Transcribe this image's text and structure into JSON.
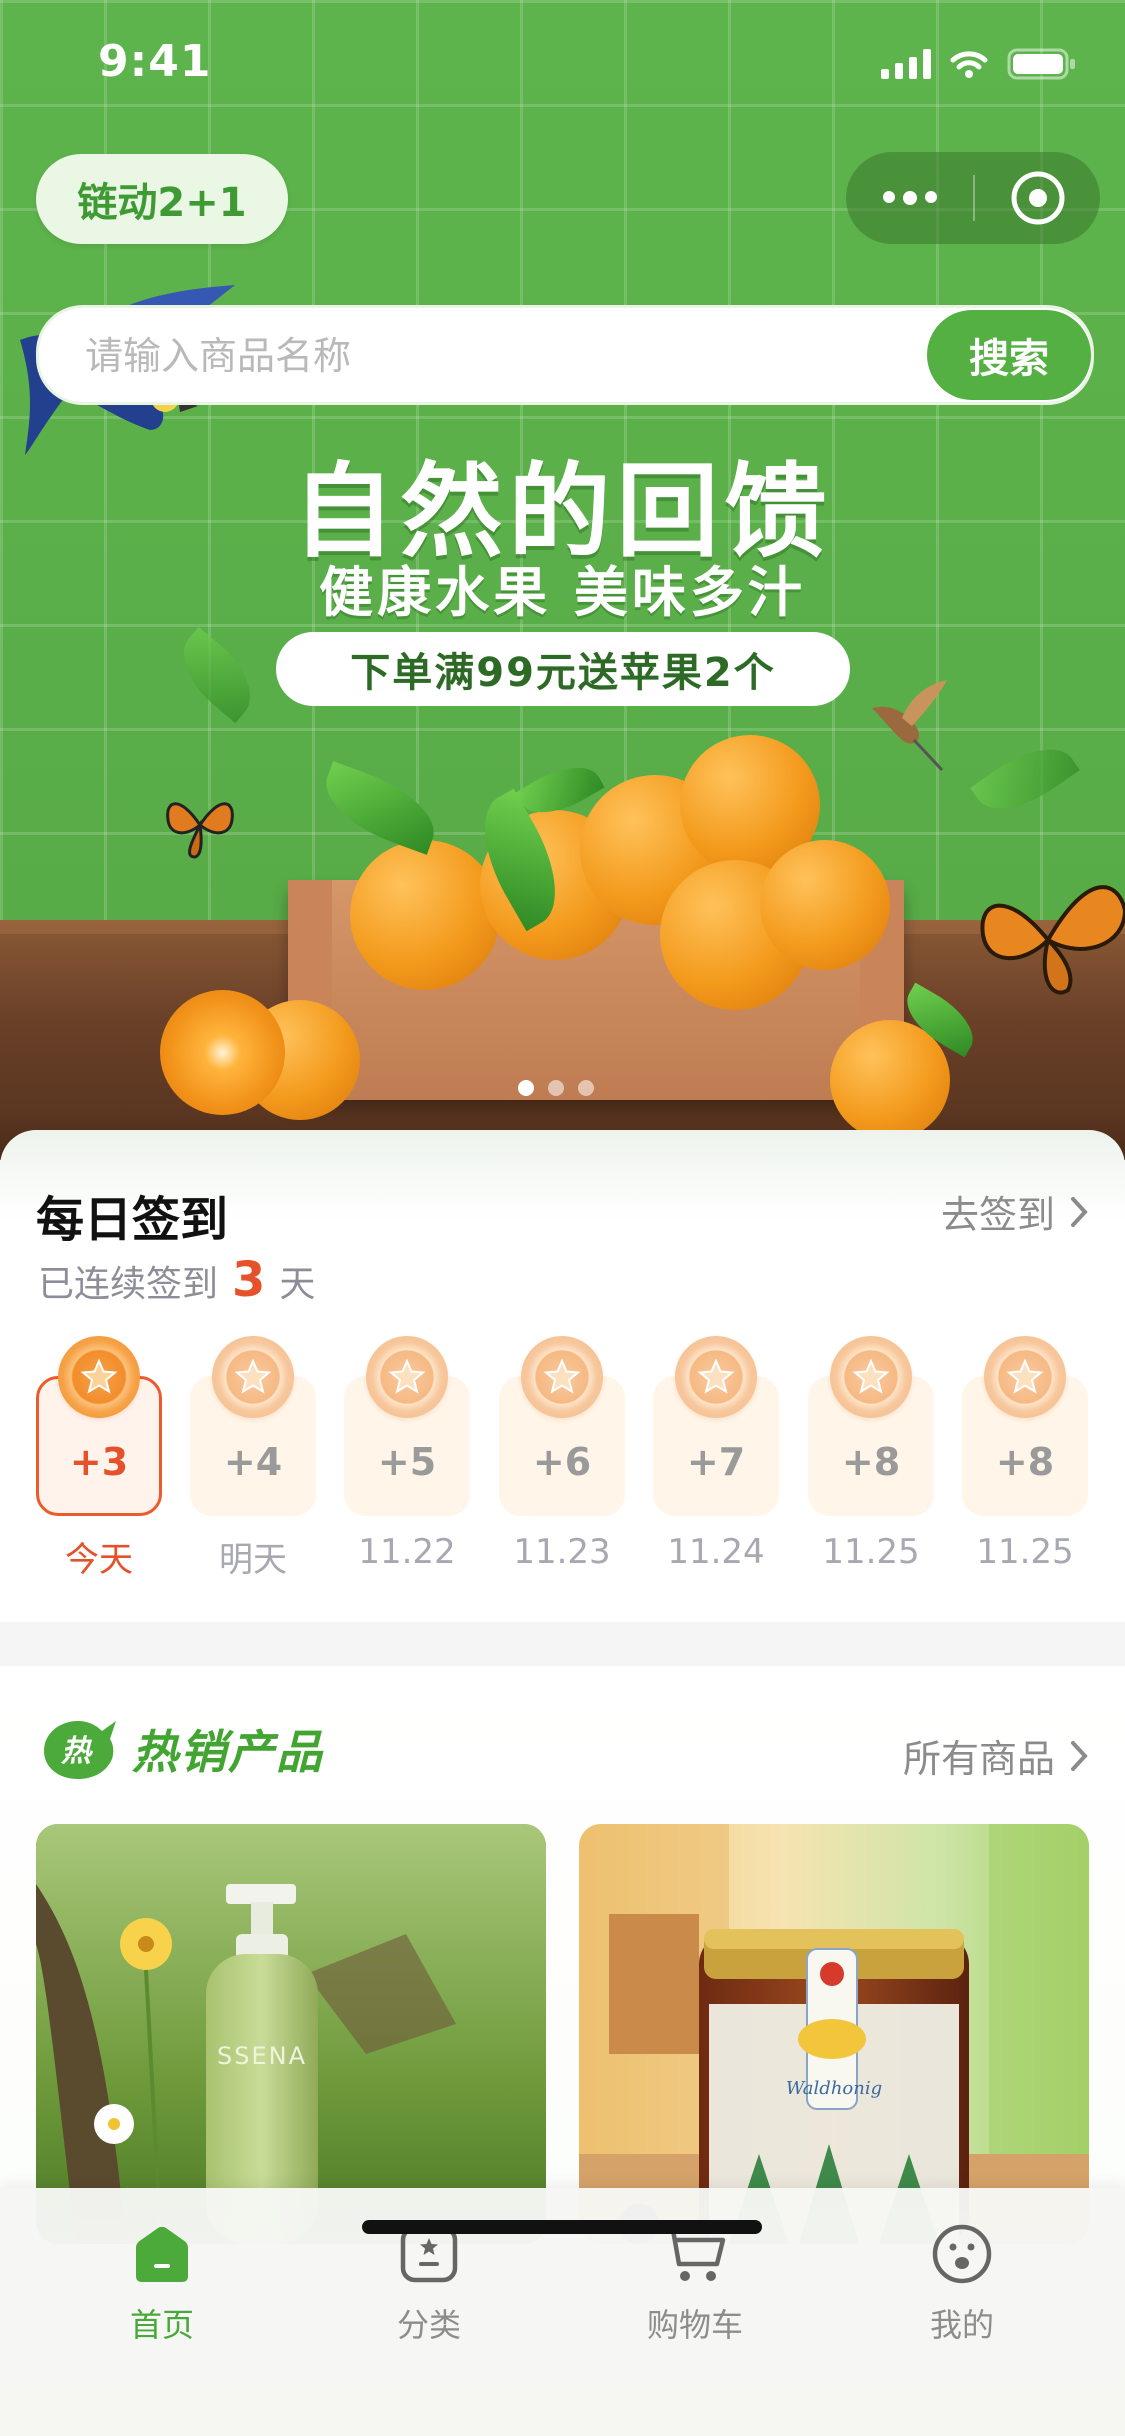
{
  "status_bar": {
    "time": "9:41"
  },
  "header": {
    "brand": "链动2+1"
  },
  "search": {
    "placeholder": "请输入商品名称",
    "button": "搜索"
  },
  "banner": {
    "title": "自然的回馈",
    "subtitle": "健康水果 美味多汁",
    "promo": "下单满99元送苹果2个",
    "slide_count": 3,
    "active_slide": 1
  },
  "checkin": {
    "title": "每日签到",
    "link": "去签到",
    "streak_prefix": "已连续签到",
    "streak_days": "3",
    "streak_suffix": "天",
    "days": [
      {
        "points": "+3",
        "label": "今天",
        "active": true
      },
      {
        "points": "+4",
        "label": "明天",
        "active": false
      },
      {
        "points": "+5",
        "label": "11.22",
        "active": false
      },
      {
        "points": "+6",
        "label": "11.23",
        "active": false
      },
      {
        "points": "+7",
        "label": "11.24",
        "active": false
      },
      {
        "points": "+8",
        "label": "11.25",
        "active": false
      },
      {
        "points": "+8",
        "label": "11.25",
        "active": false
      }
    ]
  },
  "hot": {
    "badge": "热",
    "title": "热销产品",
    "link": "所有商品",
    "products": [
      {
        "image": "green lotion bottle with flowers",
        "bottle_label": "SSENA"
      },
      {
        "image": "jar of honey with gold lid",
        "jar_label": "Waldhonig"
      }
    ]
  },
  "tabbar": {
    "tabs": [
      {
        "label": "首页",
        "icon": "home-icon",
        "active": true
      },
      {
        "label": "分类",
        "icon": "category-icon",
        "active": false
      },
      {
        "label": "购物车",
        "icon": "cart-icon",
        "active": false
      },
      {
        "label": "我的",
        "icon": "profile-icon",
        "active": false
      }
    ]
  },
  "colors": {
    "brand_green": "#54b043",
    "accent_orange": "#e5512a"
  }
}
